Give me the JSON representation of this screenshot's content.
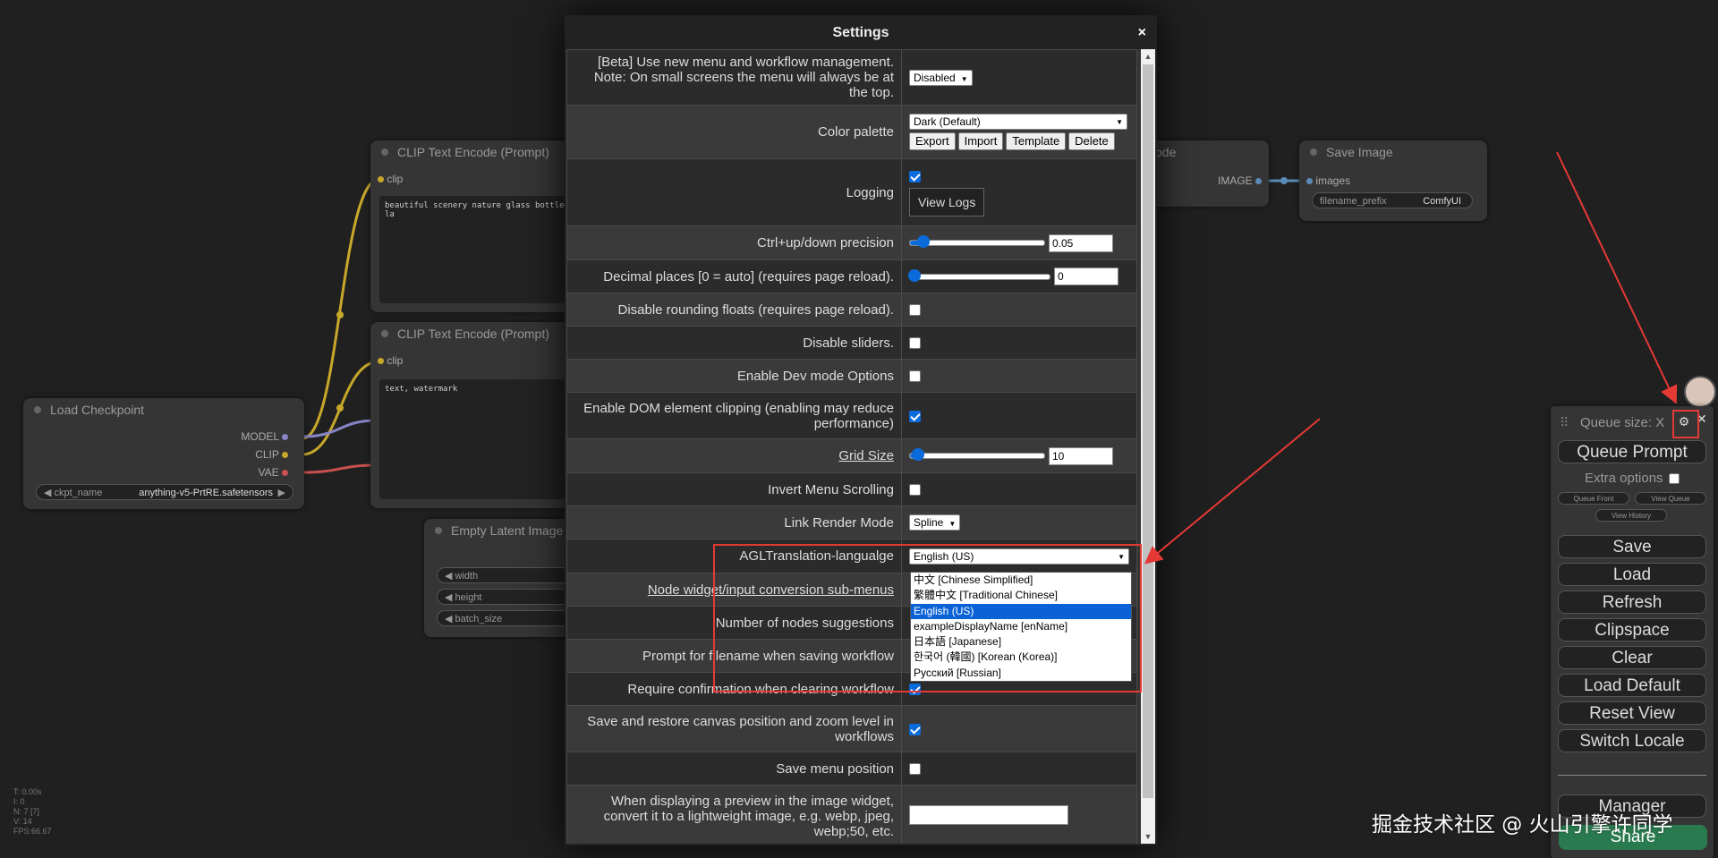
{
  "canvas": {
    "nodes": {
      "clip1": {
        "title": "CLIP Text Encode (Prompt)",
        "input": "clip",
        "text": "beautiful scenery nature glass bottle la"
      },
      "clip2": {
        "title": "CLIP Text Encode (Prompt)",
        "input": "clip",
        "text": "text, watermark"
      },
      "load_checkpoint": {
        "title": "Load Checkpoint",
        "outputs": [
          "MODEL",
          "CLIP",
          "VAE"
        ],
        "widget_label": "ckpt_name",
        "widget_value": "anything-v5-PrtRE.safetensors"
      },
      "empty_latent": {
        "title": "Empty Latent Image",
        "widgets": [
          "width",
          "height",
          "batch_size"
        ]
      },
      "decode": {
        "title": "code",
        "output": "IMAGE"
      },
      "save_image": {
        "title": "Save Image",
        "input": "images",
        "widget_label": "filename_prefix",
        "widget_value": "ComfyUI"
      }
    },
    "hud": [
      "T: 0.00s",
      "I: 0",
      "N: 7 [7]",
      "V: 14",
      "FPS:66.67"
    ]
  },
  "settings": {
    "title": "Settings",
    "close": "×",
    "rows": [
      {
        "label": "[Beta] Use new menu and workflow management. Note: On small screens the menu will always be at the top.",
        "select": "Disabled"
      },
      {
        "label": "Color palette",
        "select": "Dark (Default)",
        "buttons": [
          "Export",
          "Import",
          "Template",
          "Delete"
        ]
      },
      {
        "label": "Logging",
        "checked": true,
        "button": "View Logs"
      },
      {
        "label": "Ctrl+up/down precision",
        "slider": 0.05,
        "number": "0.05"
      },
      {
        "label": "Decimal places [0 = auto] (requires page reload).",
        "slider": 0,
        "number": "0"
      },
      {
        "label": "Disable rounding floats (requires page reload).",
        "checked": false
      },
      {
        "label": "Disable sliders.",
        "checked": false
      },
      {
        "label": "Enable Dev mode Options",
        "checked": false
      },
      {
        "label": "Enable DOM element clipping (enabling may reduce performance)",
        "checked": true
      },
      {
        "label": "Grid Size",
        "slider": 10,
        "number": "10"
      },
      {
        "label": "Invert Menu Scrolling",
        "checked": false
      },
      {
        "label": "Link Render Mode",
        "select": "Spline"
      },
      {
        "label": "AGLTranslation-langualge",
        "select": "English (US)"
      },
      {
        "label": "Node widget/input conversion sub-menus"
      },
      {
        "label": "Number of nodes suggestions"
      },
      {
        "label": "Prompt for filename when saving workflow"
      },
      {
        "label": "Require confirmation when clearing workflow",
        "checked": true
      },
      {
        "label": "Save and restore canvas position and zoom level in workflows",
        "checked": true
      },
      {
        "label": "Save menu position",
        "checked": false
      },
      {
        "label": "When displaying a preview in the image widget, convert it to a lightweight image, e.g. webp, jpeg, webp;50, etc.",
        "text": ""
      }
    ],
    "language_options": [
      "中文 [Chinese Simplified]",
      "繁體中文 [Traditional Chinese]",
      "English (US)",
      "exampleDisplayName [enName]",
      "日本語 [Japanese]",
      "한국어 (韓國) [Korean (Korea)]",
      "Русский [Russian]"
    ],
    "language_selected": "English (US)"
  },
  "menu": {
    "queue_size": "Queue size: X",
    "queue_prompt": "Queue Prompt",
    "extra_options": "Extra options",
    "queue_front": "Queue Front",
    "view_queue": "View Queue",
    "view_history": "View History",
    "buttons": [
      "Save",
      "Load",
      "Refresh",
      "Clipspace",
      "Clear",
      "Load Default",
      "Reset View",
      "Switch Locale"
    ],
    "manager": "Manager",
    "share": "Share"
  },
  "watermark": "掘金技术社区 @ 火山引擎许同学",
  "colors": {
    "accent": "#0a6cdb",
    "highlight_box": "#e53935",
    "selected_option": "#0a62d6"
  }
}
